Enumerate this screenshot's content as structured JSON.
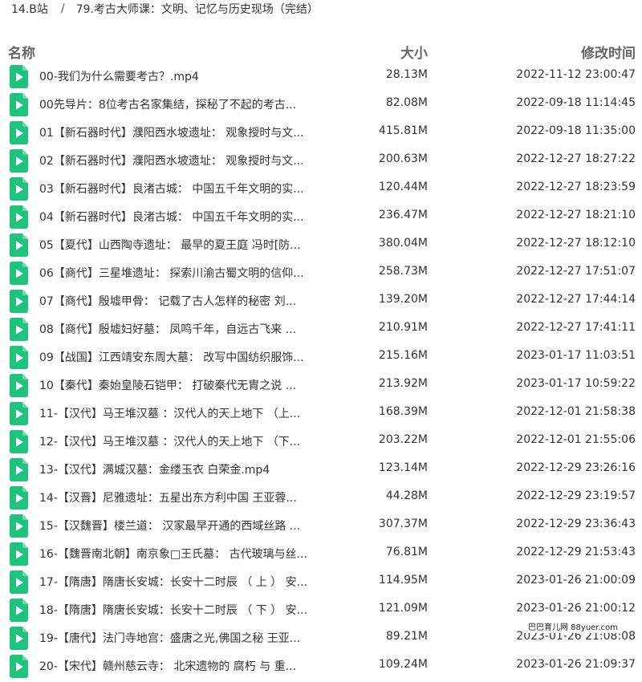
{
  "breadcrumb": {
    "root": "14.B站",
    "separator": "/",
    "current": "79.考古大师课：文明、记忆与历史现场（完结）"
  },
  "header": {
    "name": "名称",
    "size": "大小",
    "time": "修改时间"
  },
  "colors": {
    "icon_green": "#1ec47e",
    "text": "#333333",
    "header_text": "#666666"
  },
  "icon_name": "video-file-icon",
  "files": [
    {
      "name": "00-我们为什么需要考古？.mp4",
      "size": "28.13M",
      "time": "2022-11-12 23:00:47"
    },
    {
      "name": "00先导片：8位考古名家集结，探秘了不起的考古...",
      "size": "82.08M",
      "time": "2022-09-18 11:14:45"
    },
    {
      "name": "01【新石器时代】濮阳西水坡遗址： 观象授时与文...",
      "size": "415.81M",
      "time": "2022-09-18 11:35:00"
    },
    {
      "name": "02【新石器时代】濮阳西水坡遗址： 观象授时与文...",
      "size": "200.63M",
      "time": "2022-12-27 18:27:22"
    },
    {
      "name": "03【新石器时代】良渚古城： 中国五千年文明的实...",
      "size": "120.44M",
      "time": "2022-12-27 18:23:59"
    },
    {
      "name": "04【新石器时代】良渚古城： 中国五千年文明的实...",
      "size": "236.47M",
      "time": "2022-12-27 18:21:10"
    },
    {
      "name": "05【夏代】山西陶寺遗址： 最早的夏王庭 冯时[防...",
      "size": "380.04M",
      "time": "2022-12-27 18:12:10"
    },
    {
      "name": "06【商代】三星堆遗址： 探索川渝古蜀文明的信仰...",
      "size": "258.73M",
      "time": "2022-12-27 17:51:07"
    },
    {
      "name": "07【商代】殷墟甲骨： 记载了古人怎样的秘密 刘...",
      "size": "139.20M",
      "time": "2022-12-27 17:44:14"
    },
    {
      "name": "08【商代】殷墟妇好墓： 凤鸣千年，自远古飞来 ...",
      "size": "210.91M",
      "time": "2022-12-27 17:41:11"
    },
    {
      "name": "09【战国】江西靖安东周大墓： 改写中国纺织服饰...",
      "size": "215.16M",
      "time": "2023-01-17 11:03:51"
    },
    {
      "name": "10【秦代】秦始皇陵石铠甲： 打破秦代无胄之说 ...",
      "size": "213.92M",
      "time": "2023-01-17 10:59:22"
    },
    {
      "name": "11-【汉代】马王堆汉墓 ：汉代人的天上地下 （上...",
      "size": "168.39M",
      "time": "2022-12-01 21:58:38"
    },
    {
      "name": "12-【汉代】马王堆汉墓 ：汉代人的天上地下 （下...",
      "size": "203.22M",
      "time": "2022-12-01 21:55:06"
    },
    {
      "name": "13-【汉代】满城汉墓：金缕玉衣 白荣金.mp4",
      "size": "123.14M",
      "time": "2022-12-29 23:26:16"
    },
    {
      "name": "14-【汉晋】尼雅遗址：五星出东方利中国 王亚蓉...",
      "size": "44.28M",
      "time": "2022-12-29 23:19:57"
    },
    {
      "name": "15-【汉魏晋】楼兰道： 汉家最早开通的西域丝路 ...",
      "size": "307.37M",
      "time": "2022-12-29 23:36:43"
    },
    {
      "name": "16-【魏晋南北朝】南京象□王氏墓： 古代玻璃与丝...",
      "size": "76.81M",
      "time": "2022-12-29 21:53:43"
    },
    {
      "name": "17-【隋唐】隋唐长安城：长安十二时辰 （ 上 ） 安...",
      "size": "114.95M",
      "time": "2023-01-26 21:00:09"
    },
    {
      "name": "18-【隋唐】隋唐长安城：长安十二时辰 （ 下 ） 安...",
      "size": "121.09M",
      "time": "2023-01-26 21:00:12"
    },
    {
      "name": "19-【唐代】法门寺地宫：盛唐之光,佛国之秘 王亚...",
      "size": "89.21M",
      "time": "2023-01-26 21:08:08"
    },
    {
      "name": "20-【宋代】赣州慈云寺： 北宋遗物的 腐朽 与 重...",
      "size": "109.24M",
      "time": "2023-01-26 21:09:37"
    }
  ],
  "watermark": "巴巴育儿网 88yuer.com"
}
